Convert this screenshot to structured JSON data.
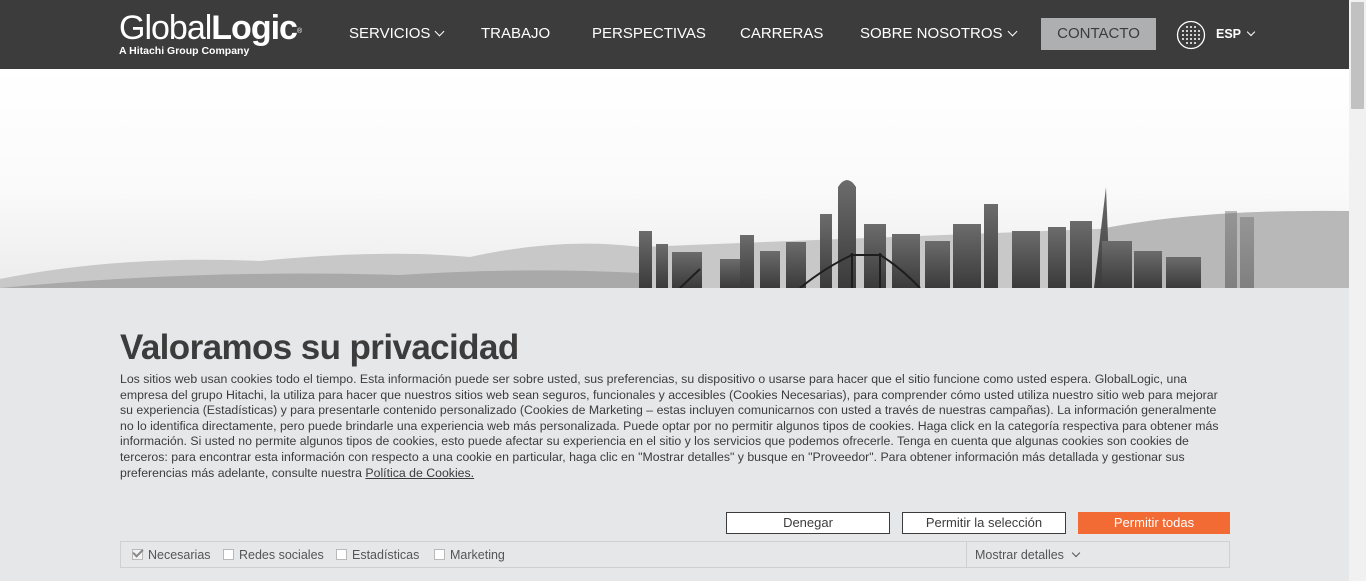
{
  "header": {
    "logo": {
      "word_thin": "Global",
      "word_bold": "Logic",
      "mark": "®",
      "tagline": "A Hitachi Group Company"
    },
    "nav": [
      {
        "label": "SERVICIOS",
        "has_dropdown": true
      },
      {
        "label": "TRABAJO",
        "has_dropdown": false
      },
      {
        "label": "PERSPECTIVAS",
        "has_dropdown": false
      },
      {
        "label": "CARRERAS",
        "has_dropdown": false
      },
      {
        "label": "SOBRE NOSOTROS",
        "has_dropdown": true
      }
    ],
    "contact_label": "CONTACTO",
    "language": {
      "icon": "globe-icon",
      "label": "ESP"
    }
  },
  "hero": {
    "image": "city-skyline-grayscale"
  },
  "cookie_banner": {
    "title": "Valoramos su privacidad",
    "body": "Los sitios web usan cookies todo el tiempo. Esta información puede ser sobre usted, sus preferencias, su dispositivo o usarse para hacer que el sitio funcione como usted espera. GlobalLogic, una empresa del grupo Hitachi, la utiliza para hacer que nuestros sitios web sean seguros, funcionales y accesibles (Cookies Necesarias), para comprender cómo usted utiliza nuestro sitio web para mejorar su experiencia (Estadísticas) y para presentarle contenido personalizado (Cookies de Marketing – estas incluyen comunicarnos con usted a través de nuestras campañas). La información generalmente no lo identifica directamente, pero puede brindarle una experiencia web más personalizada. Puede optar por no permitir algunos tipos de cookies. Haga click en la categoría respectiva para obtener más información. Si usted no permite algunos tipos de cookies, esto puede afectar su experiencia en el sitio y los servicios que podemos ofrecerle. Tenga en cuenta que algunas cookies son cookies de terceros: para encontrar esta información con respecto a una cookie en particular, haga clic en \"Mostrar detalles\" y busque en \"Proveedor\". Para obtener información más detallada y gestionar sus preferencias más adelante, consulte nuestra ",
    "policy_link": "Política de Cookies.",
    "buttons": {
      "deny": "Denegar",
      "allow_selection": "Permitir la selección",
      "allow_all": "Permitir todas"
    },
    "options": [
      {
        "label": "Necesarias",
        "checked": true
      },
      {
        "label": "Redes sociales",
        "checked": false
      },
      {
        "label": "Estadísticas",
        "checked": false
      },
      {
        "label": "Marketing",
        "checked": false
      }
    ],
    "show_details": "Mostrar detalles"
  },
  "colors": {
    "header_bg": "#3c3c3c",
    "accent": "#f26b35",
    "banner_bg": "#e6e7e9",
    "contact_bg": "#aeafb1"
  }
}
